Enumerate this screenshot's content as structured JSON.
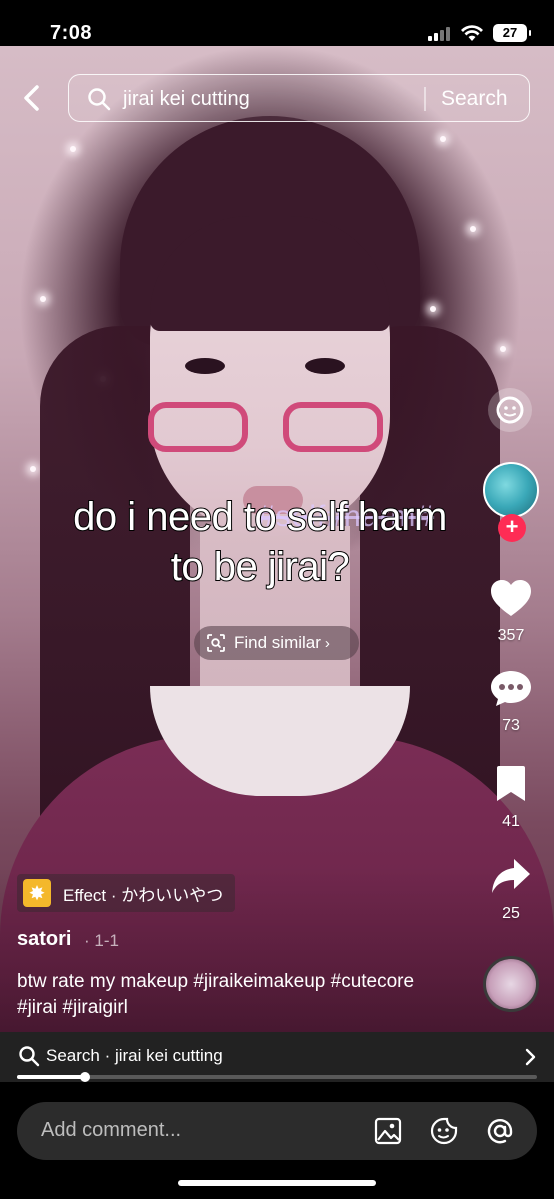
{
  "status_bar": {
    "time": "7:08",
    "battery": "27"
  },
  "search_bar": {
    "query": "jirai kei cutting",
    "search_label": "Search"
  },
  "caption": {
    "line1": "do i need to self harm",
    "line2": "to be jirai?",
    "hashtag_overlay": "#self#harm#"
  },
  "find_similar": {
    "label": "Find similar"
  },
  "actions": {
    "likes": "357",
    "comments": "73",
    "saves": "41",
    "shares": "25"
  },
  "effect": {
    "label": "Effect · かわいいやつ"
  },
  "post": {
    "username": "satori",
    "date": "· 1-1",
    "description": "btw rate my makeup #jiraikeimakeup #cutecore #jirai #jiraigirl"
  },
  "related_search": {
    "label": "Search · jirai kei cutting"
  },
  "playback": {
    "progress": 0.13
  },
  "comment_bar": {
    "placeholder": "Add comment..."
  },
  "colors": {
    "like_accent": "#fe2c55",
    "effect_icon": "#f4b82b"
  },
  "icons": [
    "back-icon",
    "search-icon",
    "scan-icon",
    "emoji-icon",
    "heart-icon",
    "comment-icon",
    "bookmark-icon",
    "share-icon",
    "image-icon",
    "sticker-icon",
    "mention-icon"
  ]
}
